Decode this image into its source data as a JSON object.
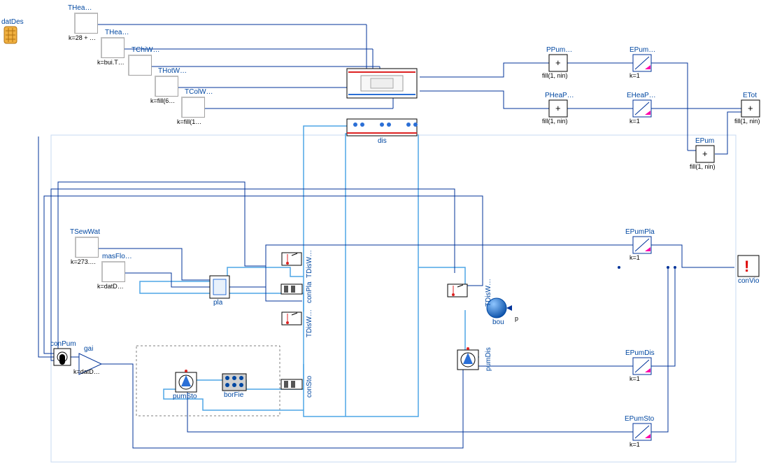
{
  "icons": {
    "datDes": "datDes"
  },
  "constants": [
    {
      "name": "THea",
      "label": "THea…",
      "sub": "k=28 + …"
    },
    {
      "name": "THea2",
      "label": "THea…",
      "sub": "k=bui.T…"
    },
    {
      "name": "TChiW",
      "label": "TChiW…",
      "sub": ""
    },
    {
      "name": "THotW",
      "label": "THotW…",
      "sub": "k=fill(6…"
    },
    {
      "name": "TColW",
      "label": "TColW…",
      "sub": "k=fill(1…"
    },
    {
      "name": "TSewWat",
      "label": "TSewWat",
      "sub": "k=273.…"
    },
    {
      "name": "masFlo",
      "label": "masFlo…",
      "sub": "k=datD…"
    }
  ],
  "sums": {
    "PPum": {
      "label": "PPum…",
      "sub": "fill(1, nin)"
    },
    "PHeaP": {
      "label": "PHeaP…",
      "sub": "fill(1, nin)"
    },
    "EPum": {
      "label": "EPum…",
      "sub": ""
    },
    "EHeaP": {
      "label": "EHeaP…",
      "sub": ""
    },
    "ETot": {
      "label": "ETot",
      "sub": "fill(1, nin)"
    },
    "EPum2": {
      "label": "EPum",
      "sub": "fill(1, nin)"
    }
  },
  "integrators": {
    "EPum_i": "EPum…",
    "EHeaP_i": "EHeaP…",
    "EPumPla": "EPumPla",
    "EPumDis": "EPumDis",
    "EPumSto": "EPumSto",
    "k1": "k=1",
    "k2": "k=1",
    "k3": "k=1",
    "k4": "k=1",
    "k5": "k=1"
  },
  "components": {
    "dis": "dis",
    "pla": "pla",
    "conPla": "conPla",
    "TDisWSup": "TDisW…",
    "TDisWRet": "TDisW…",
    "TDisWRet2": "TDisW…",
    "pumDis": "pumDis",
    "bou": "bou",
    "conPum": "conPum",
    "gai": "gai",
    "gai_k": "k=datD…",
    "pumSto": "pumSto",
    "borFie": "borFie",
    "conSto": "conSto",
    "conVio": "conVio"
  }
}
